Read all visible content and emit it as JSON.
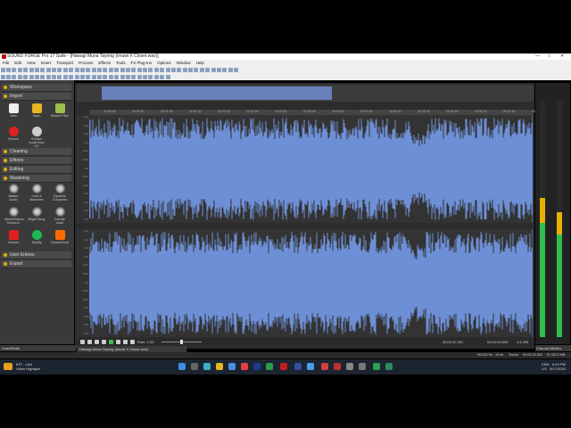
{
  "window": {
    "title": "SOUND FORGE Pro 17 Suite - [Hawagi Muna Tayong (Imuwi X Closer.wav)]"
  },
  "menu": [
    "File",
    "Edit",
    "View",
    "Insert",
    "Transport",
    "Process",
    "Effects",
    "Tools",
    "FX Plug-Ins",
    "Options",
    "Window",
    "Help"
  ],
  "sidebar": {
    "sections": [
      "Workspace",
      "Import",
      "Cleaning",
      "Effects",
      "Editing",
      "Mastering",
      "User Entries",
      "Export"
    ],
    "import_tiles": [
      "New",
      "Open",
      "Recent Files",
      "Record",
      "Extract Audio from CD"
    ],
    "mastering_tiles": [
      "Master Audio",
      "Limit & Maximize",
      "Dynamic Compress",
      "Widen/Stereo Enhance",
      "Bright Song",
      "Female Voice",
      "Youtube",
      "Spotify",
      "SoundCloud"
    ]
  },
  "ruler": {
    "ticks": [
      "00:00:00",
      "00:00:30",
      "00:01:00",
      "00:01:30",
      "00:02:00",
      "00:02:30",
      "00:03:00",
      "00:03:30",
      "00:04:00",
      "00:04:30",
      "00:05:00",
      "00:05:30",
      "00:06:00",
      "00:06:30",
      "00:07:00",
      "00:07:30"
    ]
  },
  "scale": {
    "labels": [
      "-1.0",
      "-3.0",
      "-6.0",
      "-9.0",
      "-12.0",
      "-18.0",
      "-Inf",
      "-18.0",
      "-12.0",
      "-9.0",
      "-6.0",
      "-3.0",
      "-1.0"
    ]
  },
  "transport": {
    "rate": "Rate: 1.00",
    "pos1": "00:02:37.301",
    "pos2": "00:04:33.600",
    "zoom": "1:4,096"
  },
  "doc_tab": "Hawagi Muna Tayong (Imuwi X Closer.wav)",
  "undo_tab": "Undo/Redo",
  "channel_tab": "Channel Meters",
  "status": {
    "rate": "96,000 Hz",
    "bits": "16 bit",
    "channels": "Stereo",
    "length": "00:04:33.600",
    "free": "76,750.9 MB"
  },
  "meters": {
    "left_level": 0.59,
    "right_level": 0.53
  },
  "taskbar": {
    "weather_temp": "87F - LAA",
    "weather_desc": "Video Highlight",
    "lang": "ENG",
    "region": "US",
    "time": "8:43 PM",
    "date": "8/17/2024"
  }
}
